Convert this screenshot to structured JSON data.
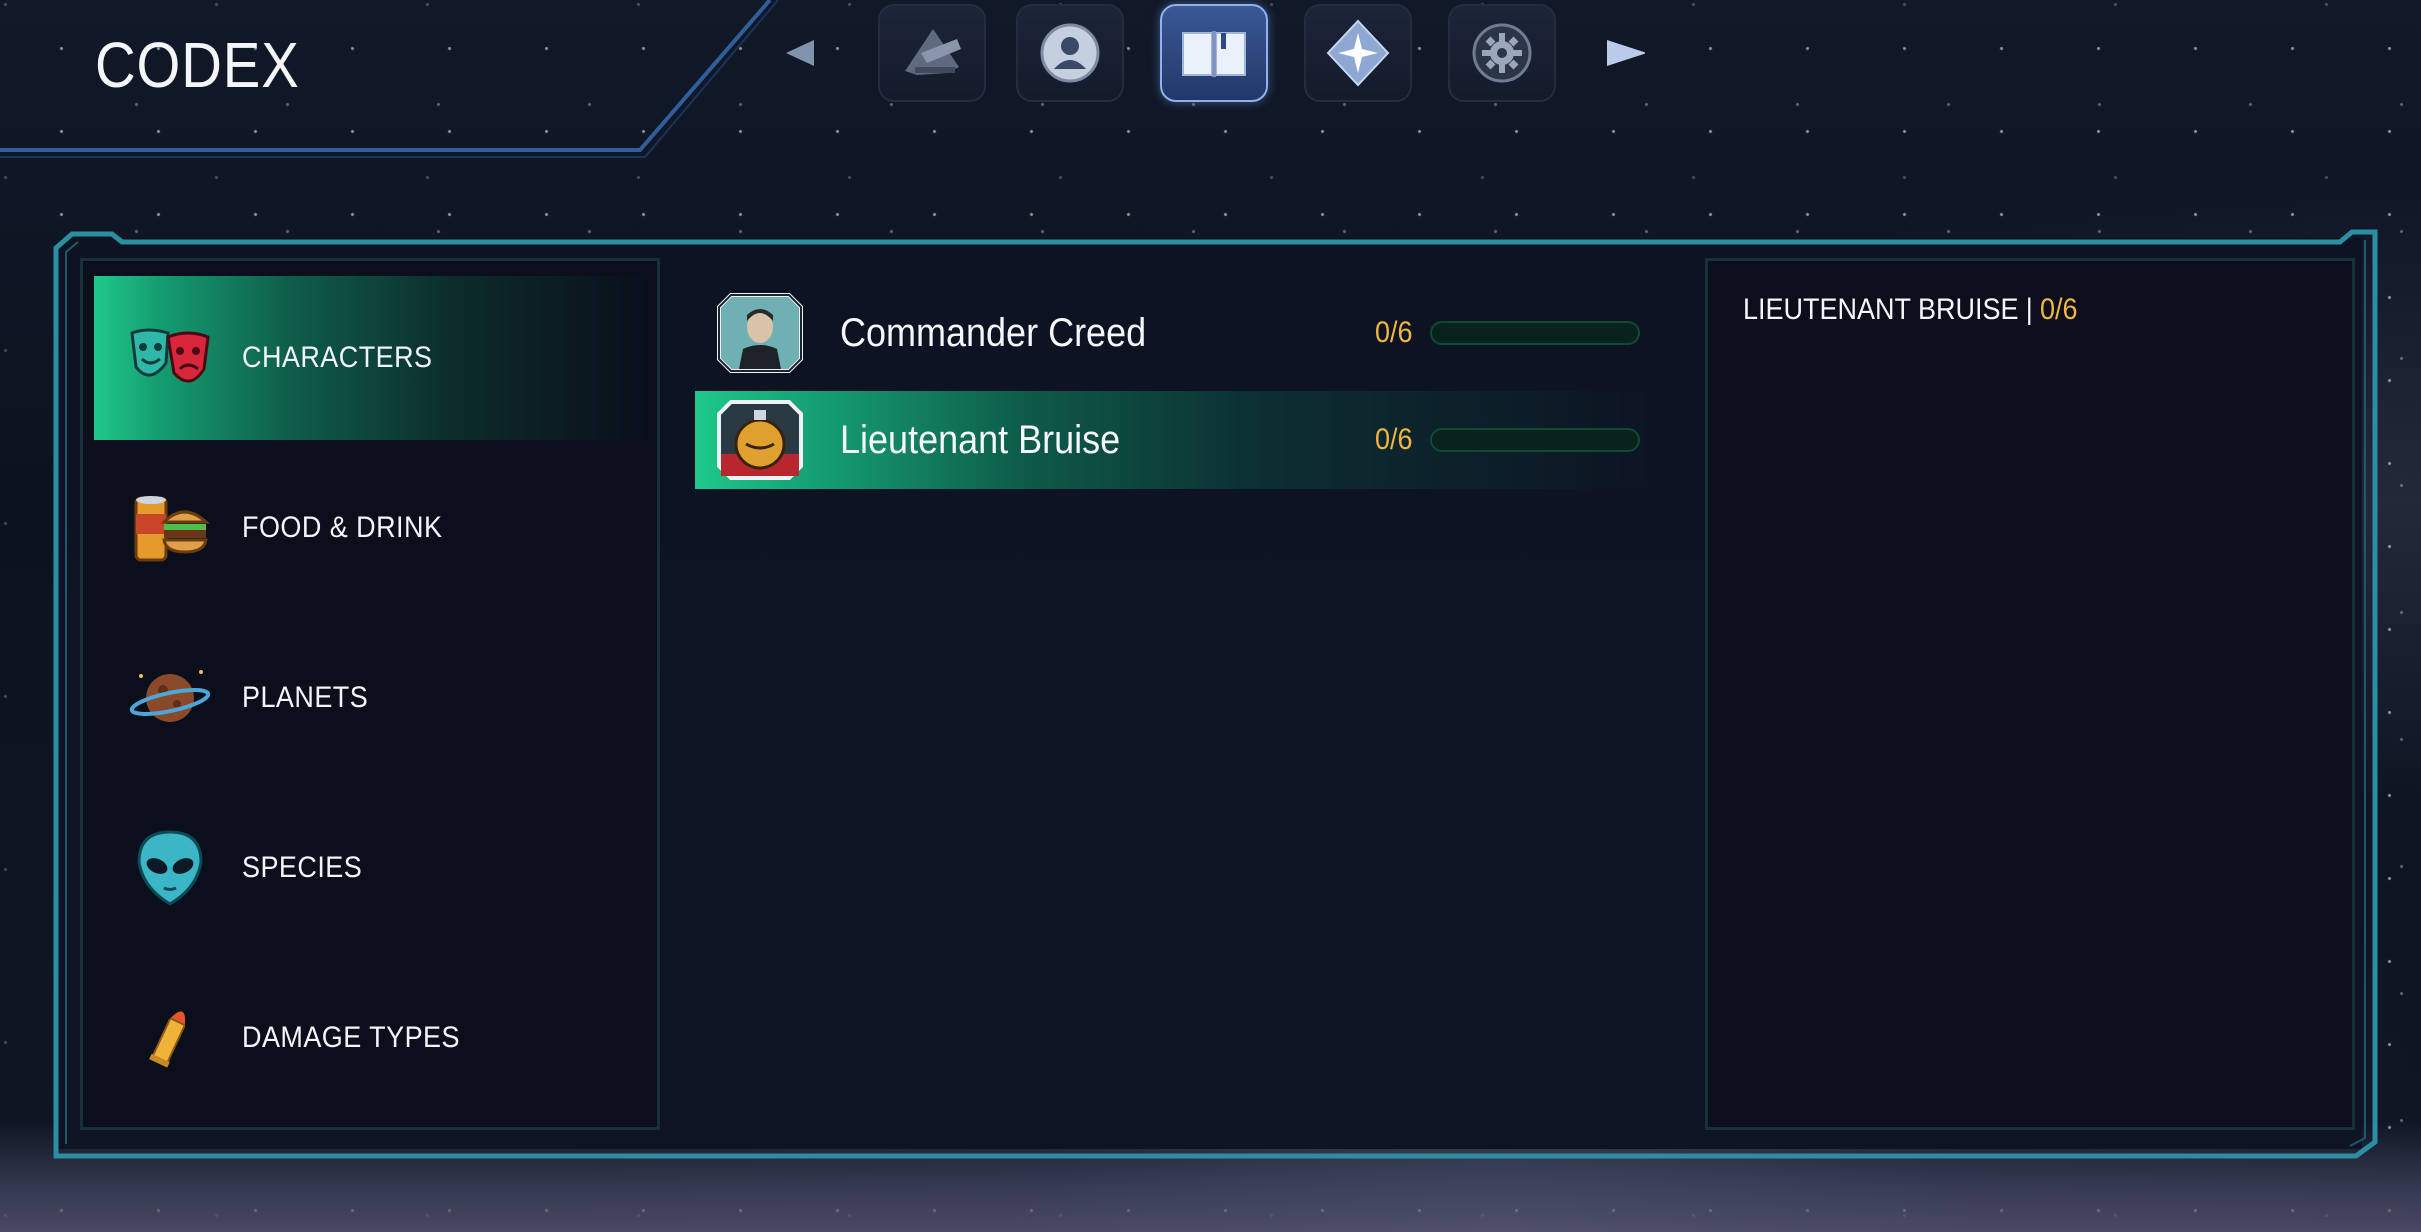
{
  "screen": {
    "title": "CODEX"
  },
  "nav": {
    "prev_icon": "triangle-left",
    "next_icon": "triangle-right",
    "tabs": [
      {
        "id": "ship",
        "icon": "ship-icon",
        "active": false
      },
      {
        "id": "profile",
        "icon": "profile-icon",
        "active": false
      },
      {
        "id": "codex",
        "icon": "book-icon",
        "active": true
      },
      {
        "id": "star",
        "icon": "star-compass-icon",
        "active": false
      },
      {
        "id": "settings",
        "icon": "gear-icon",
        "active": false
      }
    ]
  },
  "categories": [
    {
      "label": "CHARACTERS",
      "icon": "theater-masks-icon",
      "active": true
    },
    {
      "label": "FOOD & DRINK",
      "icon": "burger-soda-icon",
      "active": false
    },
    {
      "label": "PLANETS",
      "icon": "planet-icon",
      "active": false
    },
    {
      "label": "SPECIES",
      "icon": "alien-icon",
      "active": false
    },
    {
      "label": "DAMAGE TYPES",
      "icon": "bullet-icon",
      "active": false
    }
  ],
  "entries": [
    {
      "name": "Commander Creed",
      "progress": "0/6",
      "progress_fraction": 0,
      "portrait": "commander-portrait-icon",
      "active": false
    },
    {
      "name": "Lieutenant Bruise",
      "progress": "0/6",
      "progress_fraction": 0,
      "portrait": "lieutenant-portrait-icon",
      "active": true
    }
  ],
  "detail": {
    "name": "LIEUTENANT BRUISE",
    "separator": "|",
    "progress": "0/6"
  },
  "colors": {
    "accent_green": "#1fc88a",
    "progress_gold": "#f0b640",
    "frame_cyan": "#2a8fa3",
    "nav_active": "#8fb2ea"
  }
}
